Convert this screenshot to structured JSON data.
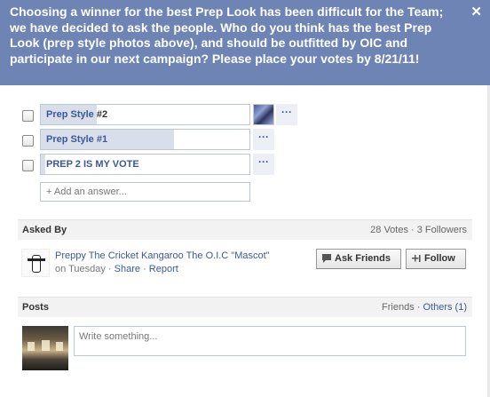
{
  "question": "Choosing a winner for the best Prep Look has been difficult for the Team; we have decided to ask the people. Who do you think has the best Prep Look (prep style photos above), and should be outfitted by OIC and participate in our next campaign? Please place your votes by 8/21/11!",
  "close_label": "✕",
  "options": [
    {
      "label": "Prep Style",
      "label_suffix": " #2",
      "vote_fraction": 0.27
    },
    {
      "label": "Prep Style #1",
      "label_suffix": "",
      "vote_fraction": 0.64
    },
    {
      "label": "PREP 2 IS MY VOTE",
      "label_suffix": "",
      "vote_fraction": 0.02
    }
  ],
  "more_label": "···",
  "add_answer_placeholder": "+ Add an answer...",
  "asked_by": {
    "section_title": "Asked By",
    "stats": "28 Votes · 3 Followers",
    "name": "Preppy The Cricket Kangaroo The O.I.C \"Mascot\"",
    "time": "on Tuesday",
    "sep1": " · ",
    "share": "Share",
    "sep2": " · ",
    "report": "Report",
    "ask_friends_label": "Ask Friends",
    "follow_label": "Follow"
  },
  "posts": {
    "section_title": "Posts",
    "filter_friends": "Friends",
    "filter_sep": " · ",
    "filter_others": "Others (1)",
    "write_placeholder": "Write something..."
  },
  "colors": {
    "header_bg": "#6d84b4",
    "link": "#3b5998",
    "bar_fill": "#d8dfea"
  },
  "icons": [
    "close-icon",
    "speech-bubble-icon",
    "plus-one-icon"
  ]
}
